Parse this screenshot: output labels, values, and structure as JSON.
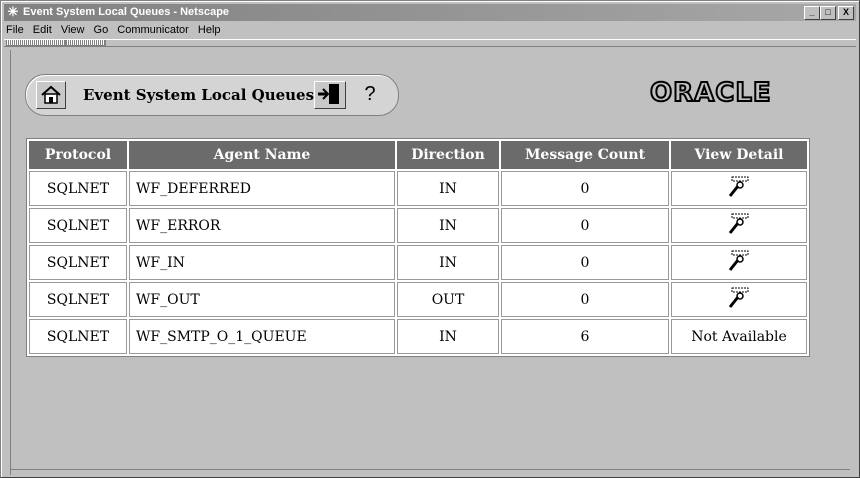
{
  "window": {
    "title": "Event System Local Queues - Netscape",
    "controls": [
      "_",
      "□",
      "X"
    ]
  },
  "menu": [
    "File",
    "Edit",
    "View",
    "Go",
    "Communicator",
    "Help"
  ],
  "nav": {
    "title": "Event System Local Queues",
    "home_icon": "home-icon",
    "exit_icon": "exit-icon",
    "help_label": "?"
  },
  "logo": "ORACLE",
  "table": {
    "headers": [
      "Protocol",
      "Agent Name",
      "Direction",
      "Message Count",
      "View Detail"
    ],
    "rows": [
      {
        "protocol": "SQLNET",
        "agent": "WF_DEFERRED",
        "direction": "IN",
        "count": "0",
        "detail": "icon"
      },
      {
        "protocol": "SQLNET",
        "agent": "WF_ERROR",
        "direction": "IN",
        "count": "0",
        "detail": "icon"
      },
      {
        "protocol": "SQLNET",
        "agent": "WF_IN",
        "direction": "IN",
        "count": "0",
        "detail": "icon"
      },
      {
        "protocol": "SQLNET",
        "agent": "WF_OUT",
        "direction": "OUT",
        "count": "0",
        "detail": "icon"
      },
      {
        "protocol": "SQLNET",
        "agent": "WF_SMTP_O_1_QUEUE",
        "direction": "IN",
        "count": "6",
        "detail": "Not Available"
      }
    ]
  },
  "colors": {
    "header_bg": "#6b6b6b",
    "page_bg": "#c0c0c0"
  }
}
